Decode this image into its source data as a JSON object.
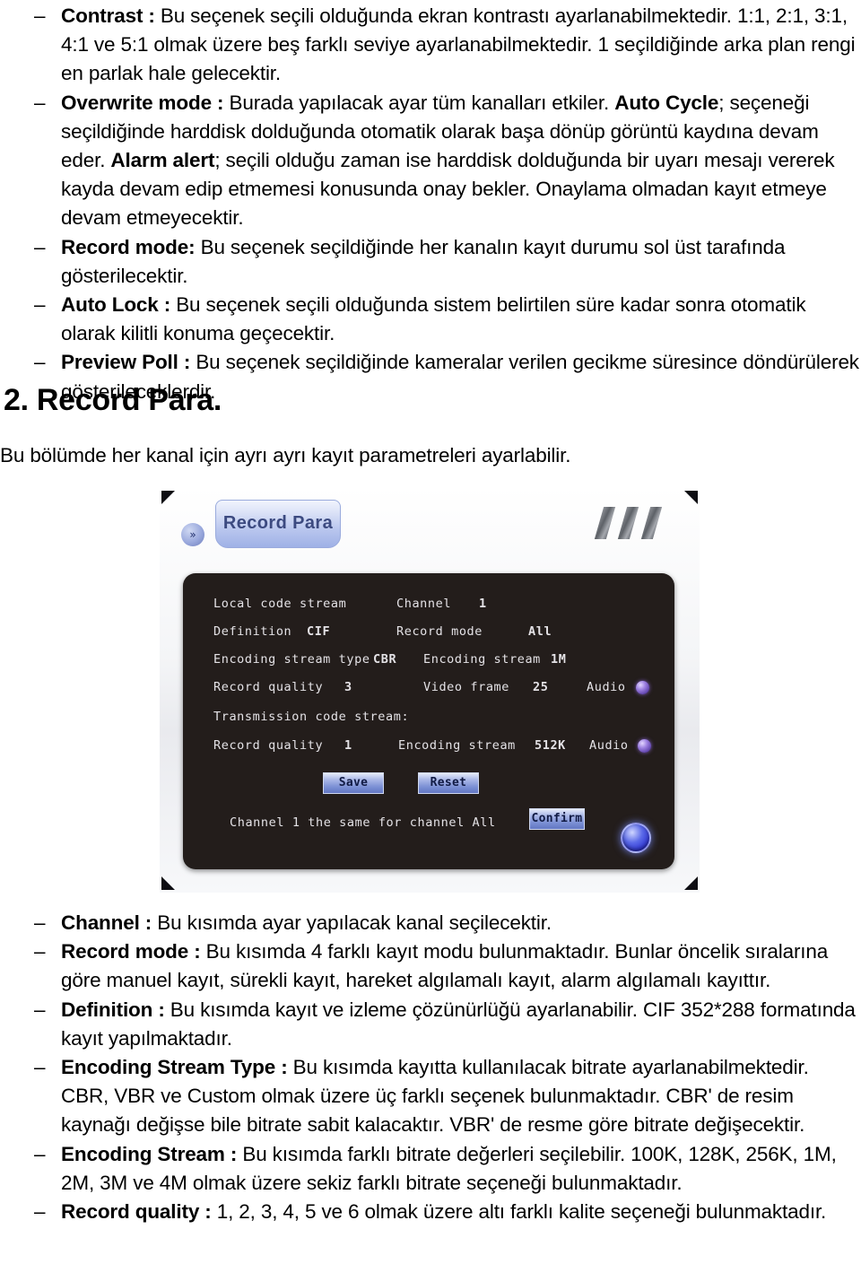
{
  "document": {
    "top_bullets": [
      {
        "marker": "–",
        "segments": [
          {
            "text": "Contrast :",
            "bold": true
          },
          {
            "text": " Bu seçenek seçili olduğunda ekran kontrastı ayarlanabilmektedir. 1:1, 2:1, 3:1, 4:1 ve 5:1 olmak üzere beş farklı seviye ayarlanabilmektedir. 1 seçildiğinde arka plan rengi en parlak hale gelecektir.",
            "bold": false
          }
        ]
      },
      {
        "marker": "–",
        "segments": [
          {
            "text": " Overwrite mode :",
            "bold": true
          },
          {
            "text": " Burada yapılacak ayar tüm kanalları etkiler. ",
            "bold": false
          },
          {
            "text": "Auto Cycle",
            "bold": true
          },
          {
            "text": "; seçeneği seçildiğinde harddisk dolduğunda otomatik olarak başa dönüp görüntü kaydına devam eder. ",
            "bold": false
          },
          {
            "text": "Alarm alert",
            "bold": true
          },
          {
            "text": "; seçili olduğu zaman ise harddisk dolduğunda bir uyarı mesajı vererek kayda devam edip etmemesi konusunda onay bekler. Onaylama olmadan kayıt etmeye devam etmeyecektir.",
            "bold": false
          }
        ]
      },
      {
        "marker": "–",
        "segments": [
          {
            "text": "Record mode:",
            "bold": true
          },
          {
            "text": " Bu seçenek seçildiğinde her kanalın kayıt durumu sol üst tarafında gösterilecektir.",
            "bold": false
          }
        ]
      },
      {
        "marker": "–",
        "segments": [
          {
            "text": "Auto Lock :",
            "bold": true
          },
          {
            "text": " Bu seçenek seçili olduğunda sistem belirtilen süre kadar sonra otomatik olarak kilitli konuma geçecektir.",
            "bold": false
          }
        ]
      },
      {
        "marker": "–",
        "segments": [
          {
            "text": "Preview Poll :",
            "bold": true
          },
          {
            "text": " Bu seçenek seçildiğinde kameralar verilen gecikme süresince döndürülerek gösterileceklerdir.",
            "bold": false
          }
        ]
      }
    ],
    "heading": "2. Record Para.",
    "intro": "Bu bölümde her kanal için ayrı ayrı kayıt parametreleri ayarlabilir.",
    "bottom_bullets": [
      {
        "marker": "–",
        "segments": [
          {
            "text": "Channel :",
            "bold": true
          },
          {
            "text": " Bu kısımda ayar yapılacak kanal seçilecektir.",
            "bold": false
          }
        ]
      },
      {
        "marker": "–",
        "segments": [
          {
            "text": "Record mode :",
            "bold": true
          },
          {
            "text": " Bu kısımda 4 farklı kayıt modu bulunmaktadır. Bunlar öncelik sıralarına göre manuel kayıt, sürekli kayıt, hareket algılamalı kayıt, alarm algılamalı kayıttır.",
            "bold": false
          }
        ]
      },
      {
        "marker": "–",
        "segments": [
          {
            "text": "Definition :",
            "bold": true
          },
          {
            "text": " Bu kısımda kayıt ve izleme çözünürlüğü ayarlanabilir. CIF 352*288 formatında kayıt yapılmaktadır.",
            "bold": false
          }
        ]
      },
      {
        "marker": "–",
        "segments": [
          {
            "text": "Encoding Stream Type :",
            "bold": true
          },
          {
            "text": " Bu kısımda kayıtta kullanılacak bitrate ayarlanabilmektedir.  CBR, VBR ve Custom olmak üzere üç farklı seçenek bulunmaktadır.  CBR' de resim kaynağı değişse bile bitrate sabit kalacaktır. VBR' de resme göre bitrate değişecektir.",
            "bold": false
          }
        ]
      },
      {
        "marker": "–",
        "segments": [
          {
            "text": "Encoding Stream :",
            "bold": true
          },
          {
            "text": " Bu kısımda farklı bitrate değerleri seçilebilir. 100K, 128K, 256K, 1M, 2M, 3M ve 4M olmak üzere sekiz farklı bitrate seçeneği bulunmaktadır.",
            "bold": false
          }
        ]
      },
      {
        "marker": "–",
        "segments": [
          {
            "text": "Record quality :",
            "bold": true
          },
          {
            "text": " 1, 2, 3, 4, 5 ve 6 olmak üzere altı farklı kalite seçeneği bulunmaktadır.",
            "bold": false
          }
        ]
      }
    ]
  },
  "dvr_dialog": {
    "back_icon_glyph": "»",
    "tab_label": "Record Para",
    "fields": {
      "section1_title": "Local code stream",
      "channel_label": "Channel",
      "channel_value": "1",
      "definition_label": "Definition",
      "definition_value": "CIF",
      "record_mode_label": "Record mode",
      "record_mode_value": "All",
      "encoding_stream_type_label": "Encoding stream type",
      "encoding_stream_type_value": "CBR",
      "encoding_stream_label": "Encoding stream",
      "encoding_stream_value": "1M",
      "record_quality_label": "Record quality",
      "record_quality_value": "3",
      "video_frame_label": "Video frame",
      "video_frame_value": "25",
      "audio_label": "Audio",
      "section2_title": "Transmission code stream:",
      "record_quality2_label": "Record quality",
      "record_quality2_value": "1",
      "encoding_stream2_label": "Encoding stream",
      "encoding_stream2_value": "512K",
      "audio2_label": "Audio"
    },
    "buttons": {
      "save": "Save",
      "reset": "Reset",
      "confirm": "Confirm"
    },
    "copy_row": "Channel 1 the same for channel All",
    "colors": {
      "panel_bg": "#231d1b",
      "tab_accent": "#9fb1e6",
      "led": "#8a6fd6",
      "power_btn": "#2a2fd0"
    }
  }
}
